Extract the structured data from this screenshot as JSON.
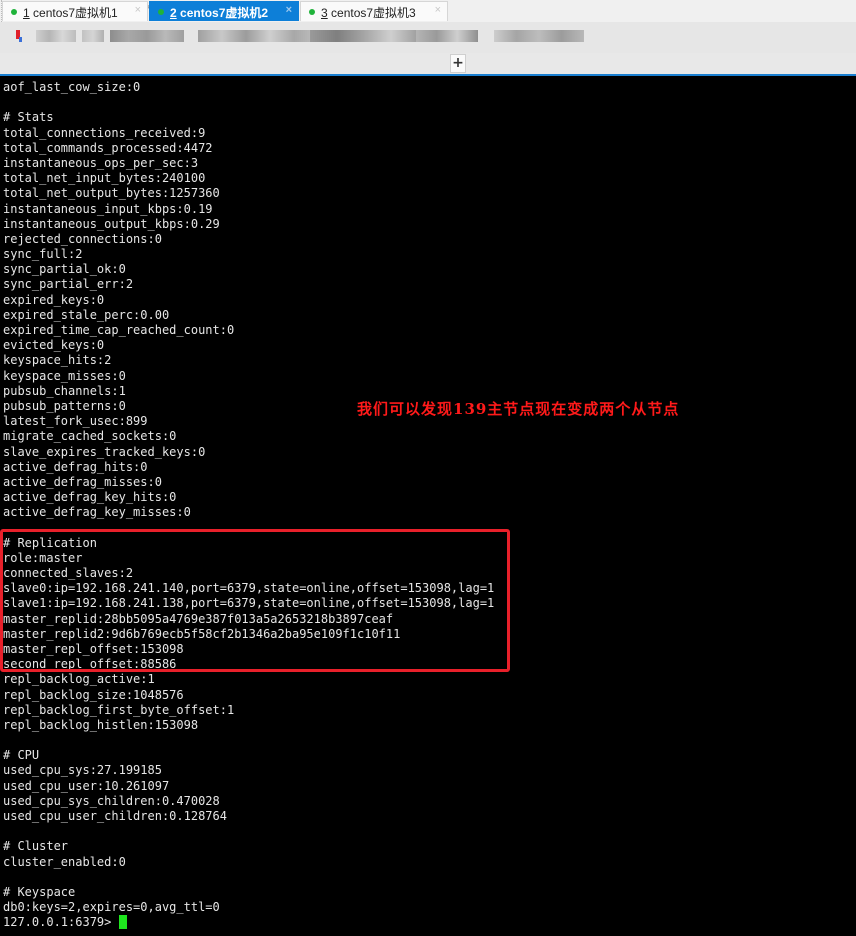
{
  "window": {
    "address": "ssh://root:************@192.168.241.139:22"
  },
  "tabs": [
    {
      "num": "1",
      "label": " centos7虚拟机1",
      "active": false,
      "close": "×"
    },
    {
      "num": "2",
      "label": " centos7虚拟机2",
      "active": true,
      "close": "×"
    },
    {
      "num": "3",
      "label": " centos7虚拟机3",
      "active": false,
      "close": "×"
    }
  ],
  "new_tab_label": "+",
  "terminal": {
    "lines": [
      "aof_last_cow_size:0",
      "",
      "# Stats",
      "total_connections_received:9",
      "total_commands_processed:4472",
      "instantaneous_ops_per_sec:3",
      "total_net_input_bytes:240100",
      "total_net_output_bytes:1257360",
      "instantaneous_input_kbps:0.19",
      "instantaneous_output_kbps:0.29",
      "rejected_connections:0",
      "sync_full:2",
      "sync_partial_ok:0",
      "sync_partial_err:2",
      "expired_keys:0",
      "expired_stale_perc:0.00",
      "expired_time_cap_reached_count:0",
      "evicted_keys:0",
      "keyspace_hits:2",
      "keyspace_misses:0",
      "pubsub_channels:1",
      "pubsub_patterns:0",
      "latest_fork_usec:899",
      "migrate_cached_sockets:0",
      "slave_expires_tracked_keys:0",
      "active_defrag_hits:0",
      "active_defrag_misses:0",
      "active_defrag_key_hits:0",
      "active_defrag_key_misses:0",
      "",
      "# Replication",
      "role:master",
      "connected_slaves:2",
      "slave0:ip=192.168.241.140,port=6379,state=online,offset=153098,lag=1",
      "slave1:ip=192.168.241.138,port=6379,state=online,offset=153098,lag=1",
      "master_replid:28bb5095a4769e387f013a5a2653218b3897ceaf",
      "master_replid2:9d6b769ecb5f58cf2b1346a2ba95e109f1c10f11",
      "master_repl_offset:153098",
      "second_repl_offset:88586",
      "repl_backlog_active:1",
      "repl_backlog_size:1048576",
      "repl_backlog_first_byte_offset:1",
      "repl_backlog_histlen:153098",
      "",
      "# CPU",
      "used_cpu_sys:27.199185",
      "used_cpu_user:10.261097",
      "used_cpu_sys_children:0.470028",
      "used_cpu_user_children:0.128764",
      "",
      "# Cluster",
      "cluster_enabled:0",
      "",
      "# Keyspace",
      "db0:keys=2,expires=0,avg_ttl=0"
    ],
    "prompt": "127.0.0.1:6379> "
  },
  "annotation": "我们可以发现139主节点现在变成两个从节点",
  "colors": {
    "tab_active": "#0d7fd8",
    "status_dot": "#1fb33a",
    "annotation": "#ff1a1a",
    "highlight_box": "#e8202a",
    "cursor": "#1ee61e"
  }
}
